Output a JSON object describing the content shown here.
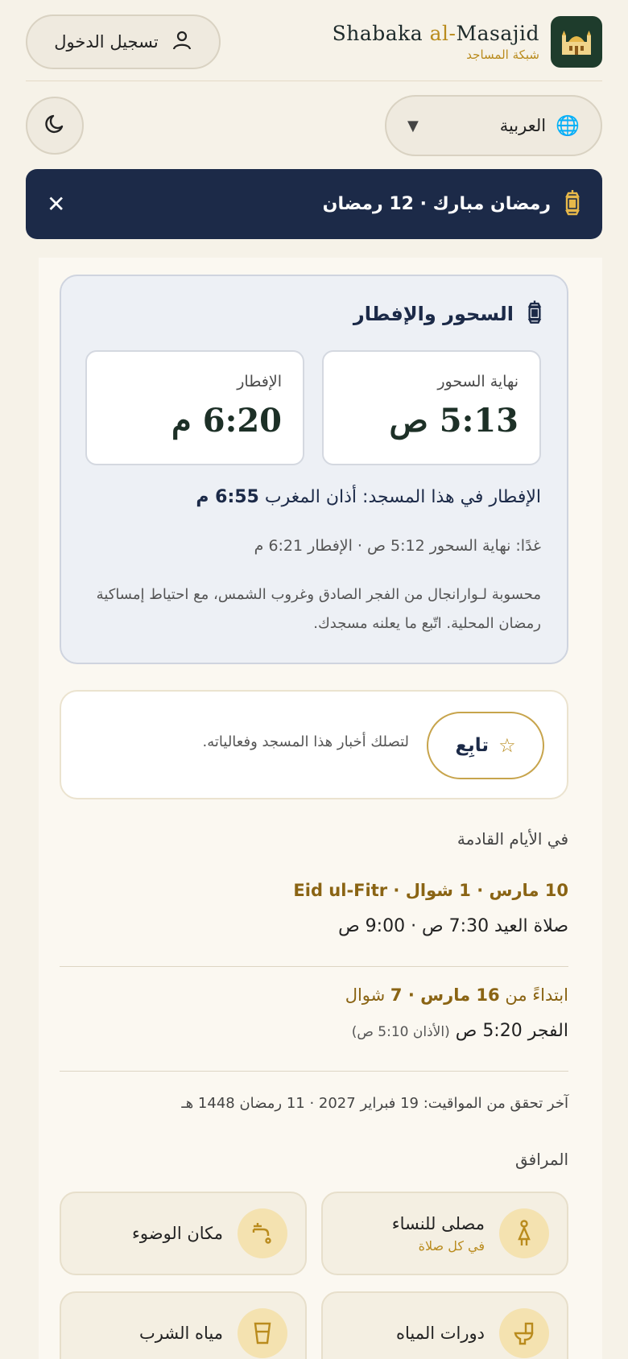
{
  "brand": {
    "title_pre": "Shabaka ",
    "title_al": "al-",
    "title_post": "Masajid",
    "subtitle": "شبكة المساجد"
  },
  "header": {
    "login_label": "تسجيل الدخول",
    "language_label": "العربية"
  },
  "banner": {
    "text": "رمضان مبارك · 12 رمضان"
  },
  "fasting": {
    "title": "السحور والإفطار",
    "suhoor_label": "نهاية السحور",
    "suhoor_time": "5:13 ص",
    "iftar_label": "الإفطار",
    "iftar_time": "6:20 م",
    "mosque_iftar_prefix": "الإفطار في هذا المسجد: أذان المغرب ",
    "mosque_iftar_time": "6:55 م",
    "tomorrow": "غدًا: نهاية السحور 5:12 ص · الإفطار 6:21 م",
    "note": "محسوبة لـوارانجال من الفجر الصادق وغروب الشمس، مع احتياط إمساكية رمضان المحلية. اتّبع ما يعلنه مسجدك."
  },
  "follow": {
    "button_label": "تابِع",
    "text": "لتصلك أخبار هذا المسجد وفعالياته."
  },
  "upcoming": {
    "title": "في الأيام القادمة",
    "events": [
      {
        "head_date": "10 مارس · 1 شوال · ",
        "head_name": "Eid ul-Fitr",
        "body": "صلاة العيد 7:30 ص · 9:00 ص",
        "body_note": ""
      },
      {
        "head_prefix": "ابتداءً من ",
        "head_date": "16 مارس · 7",
        "head_suffix": " شوال",
        "body": "الفجر 5:20 ص ",
        "body_note": "(الأذان 5:10 ص)"
      }
    ]
  },
  "verified": "آخر تحقق من المواقيت: 19 فبراير 2027 · 11 رمضان 1448 هـ",
  "facilities": {
    "title": "المرافق",
    "items": [
      {
        "name": "مصلى للنساء",
        "sub": "في كل صلاة",
        "icon": "woman-icon"
      },
      {
        "name": "مكان الوضوء",
        "sub": "",
        "icon": "tap-icon"
      },
      {
        "name": "دورات المياه",
        "sub": "",
        "icon": "toilet-icon"
      },
      {
        "name": "مياه الشرب",
        "sub": "",
        "icon": "glass-icon"
      }
    ]
  },
  "colors": {
    "navy": "#1c2a48",
    "gold": "#b98b1d",
    "green": "#1e3c2c",
    "background": "#f6f2e8"
  }
}
